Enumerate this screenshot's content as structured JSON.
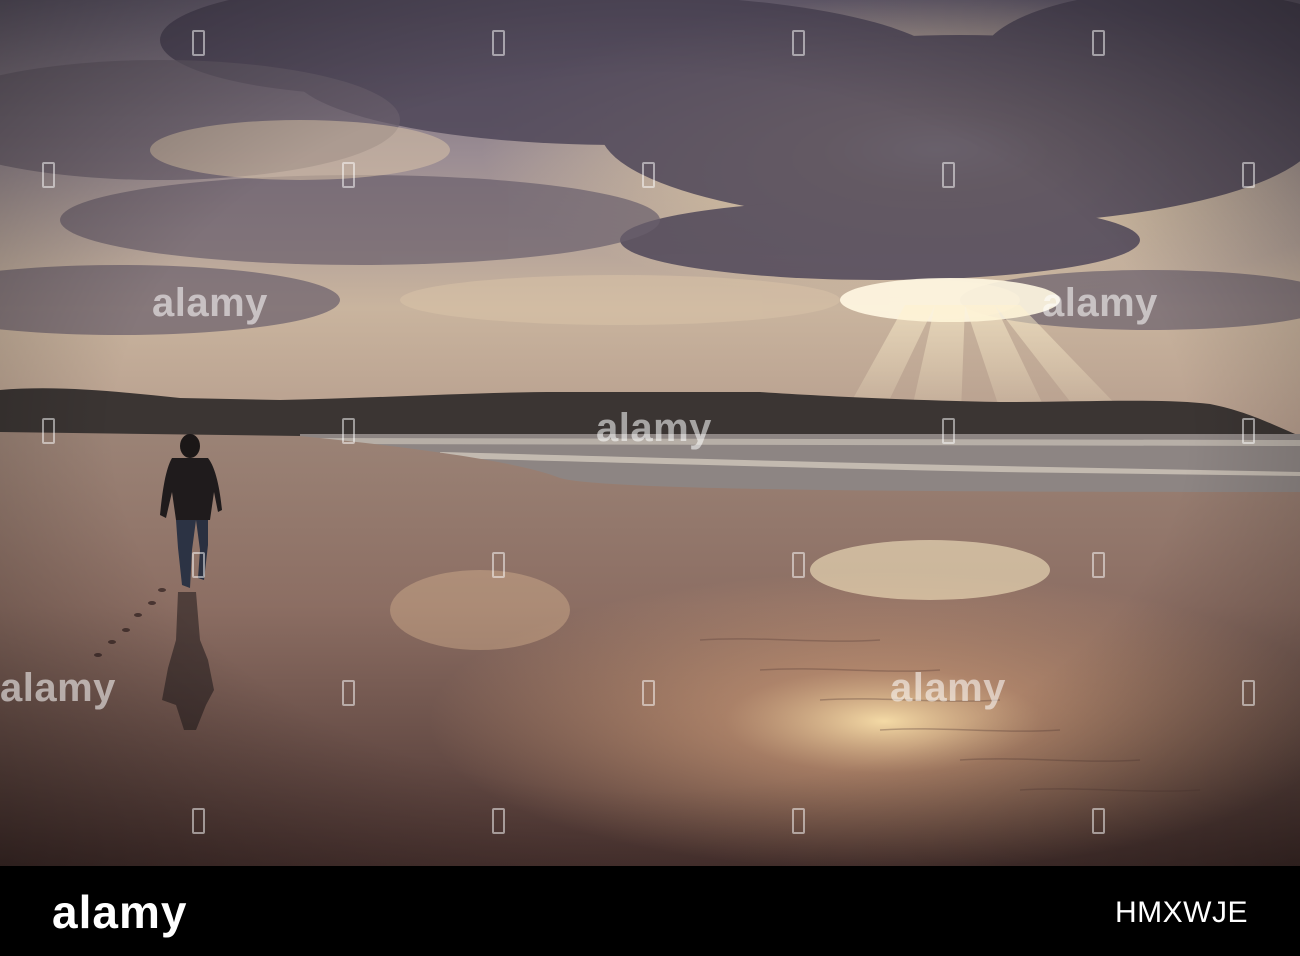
{
  "photo": {
    "subject": "person-walking-on-beach",
    "colors": {
      "sky_dark": "#4a4354",
      "sky_light": "#e9d8b8",
      "sun": "#fff4d6",
      "sand": "#8a6a5e",
      "headland": "#3b3533"
    }
  },
  "watermark": {
    "text": "alamy"
  },
  "footer": {
    "logo_text": "alamy",
    "image_id": "HMXWJE"
  }
}
